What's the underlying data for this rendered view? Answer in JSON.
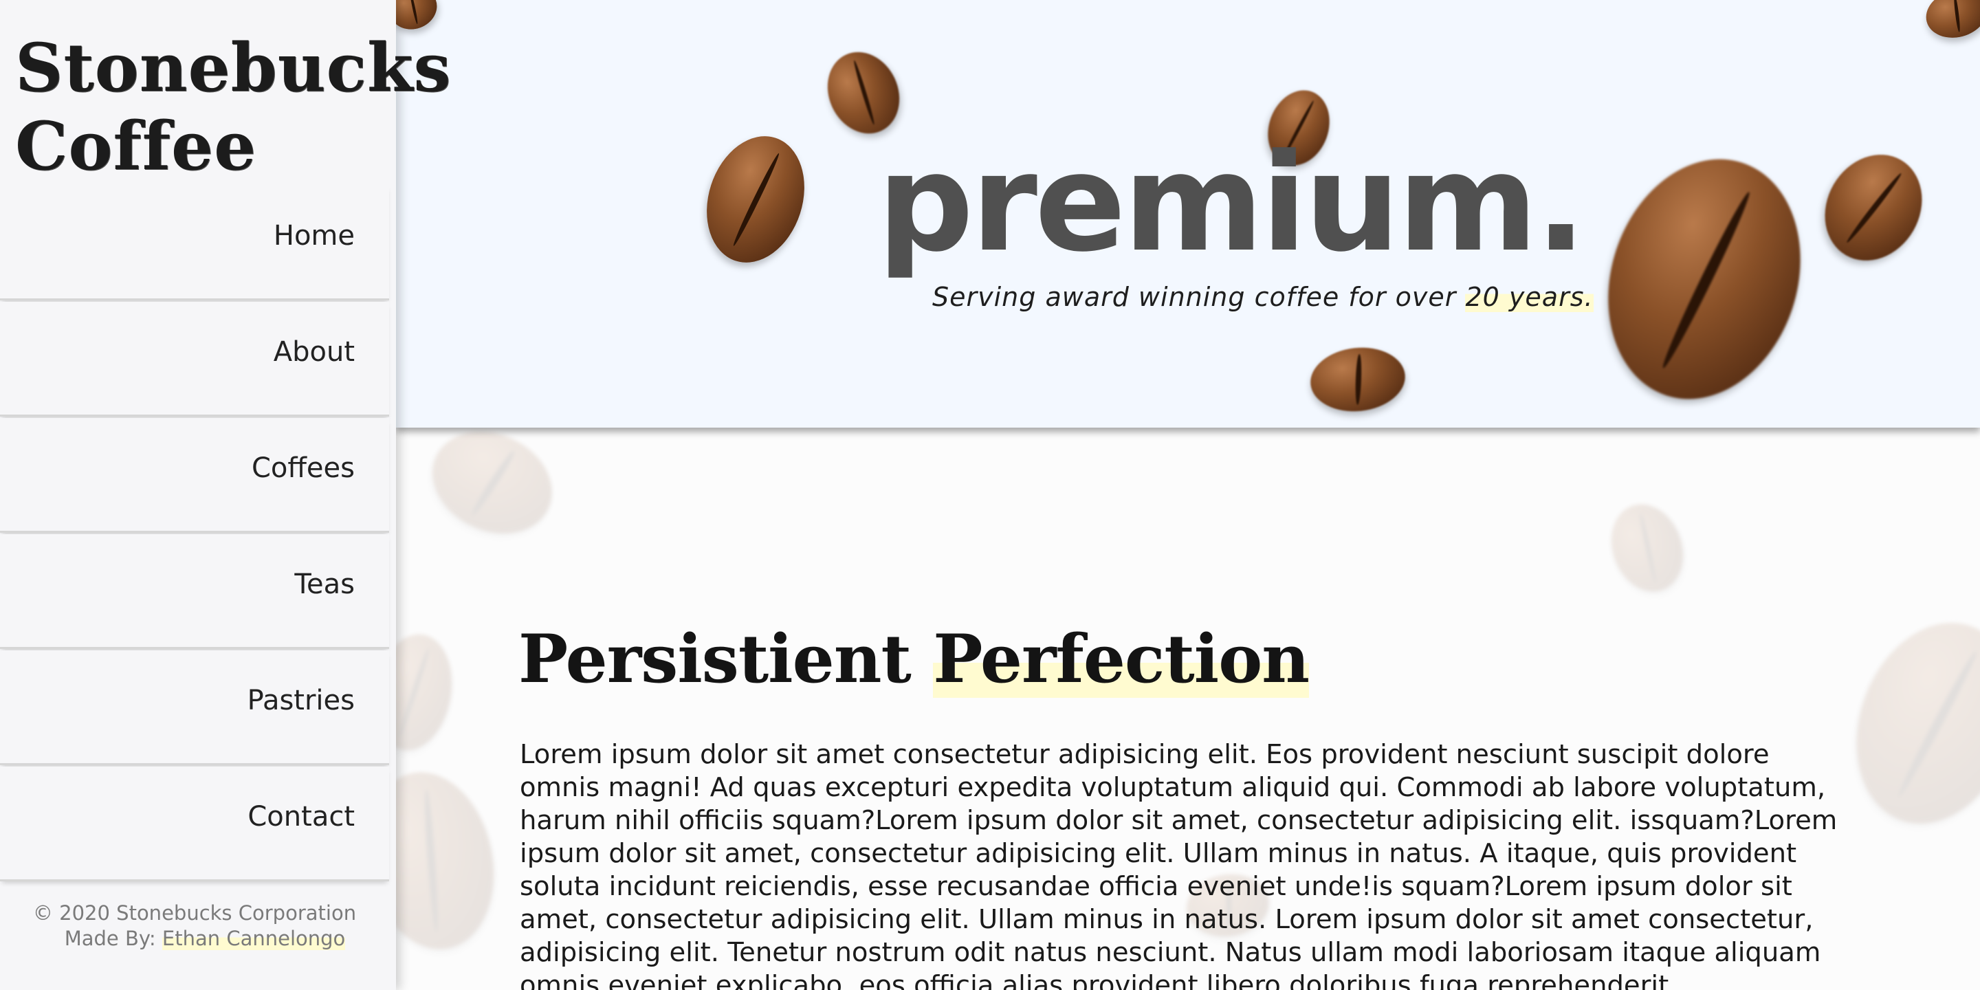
{
  "brand": {
    "line1": "Stonebucks",
    "line2": "Coffee"
  },
  "nav": {
    "items": [
      {
        "label": "Home"
      },
      {
        "label": "About"
      },
      {
        "label": "Coffees"
      },
      {
        "label": "Teas"
      },
      {
        "label": "Pastries"
      },
      {
        "label": "Contact"
      }
    ]
  },
  "footer": {
    "copyright": "© 2020 Stonebucks Corporation",
    "made_by_prefix": "Made By:",
    "author": "Ethan Cannelongo"
  },
  "hero": {
    "title": "premium.",
    "subtitle_start": "Serving award winning coffee for over",
    "subtitle_highlight": "20 years."
  },
  "section": {
    "title_start": "Persistient",
    "title_highlight": "Perfection",
    "body": "Lorem ipsum dolor sit amet consectetur adipisicing elit. Eos provident nesciunt suscipit dolore omnis magni! Ad quas excepturi expedita voluptatum aliquid qui. Commodi ab labore voluptatum, harum nihil officiis squam?Lorem ipsum dolor sit amet, consectetur adipisicing elit. issquam?Lorem ipsum dolor sit amet, consectetur adipisicing elit. Ullam minus in natus. A itaque, quis provident soluta incidunt reiciendis, esse recusandae officia eveniet unde!is squam?Lorem ipsum dolor sit amet, consectetur adipisicing elit. Ullam minus in natus. Lorem ipsum dolor sit amet consectetur, adipisicing elit. Tenetur nostrum odit natus nesciunt. Natus ullam modi laboriosam itaque aliquam omnis eveniet explicabo, eos officia alias provident libero doloribus fuga reprehenderit."
  },
  "colors": {
    "sidebar_bg": "#f6f6f8",
    "hero_bg": "#f3f8ff",
    "main_bg": "#fcfcfc",
    "highlight": "#fffbd0",
    "hero_title": "#505050",
    "footer_text": "#7a7a7a"
  }
}
